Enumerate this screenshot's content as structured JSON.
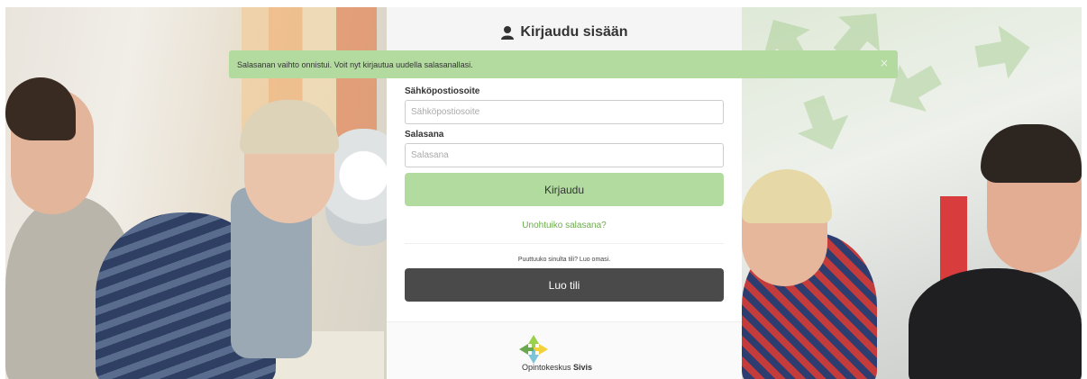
{
  "header": {
    "title": "Kirjaudu sisään",
    "icon": "user-icon"
  },
  "alert": {
    "message": "Salasanan vaihto onnistui. Voit nyt kirjautua uudella salasanallasi.",
    "close": "×",
    "color": "#b3dba0"
  },
  "form": {
    "email_label": "Sähköpostiosoite",
    "email_placeholder": "Sähköpostiosoite",
    "email_value": "",
    "password_label": "Salasana",
    "password_placeholder": "Salasana",
    "password_value": "",
    "login_button": "Kirjaudu",
    "forgot_link": "Unohtuiko salasana?",
    "no_account_text": "Puuttuuko sinulta tili? Luo omasi.",
    "create_button": "Luo tili"
  },
  "footer": {
    "logo_text_prefix": "Opintokeskus",
    "logo_text_brand": "Sivis",
    "logo_icon": "sivis-logo-icon"
  },
  "colors": {
    "accent": "#b2dba0",
    "link": "#6cab4e",
    "dark_button": "#4a4a4a"
  }
}
